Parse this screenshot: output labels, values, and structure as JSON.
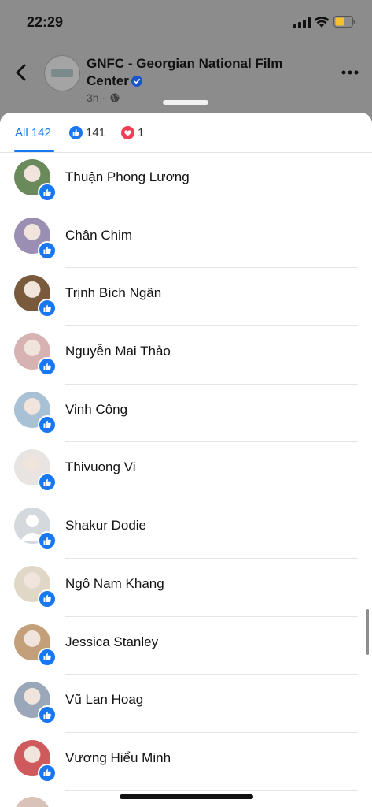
{
  "status_bar": {
    "time": "22:29"
  },
  "post": {
    "page_name": "GNFC - Georgian National Film Center",
    "time_ago": "3h",
    "separator": "·"
  },
  "tabs": {
    "all": "All 142",
    "like_count": "141",
    "love_count": "1"
  },
  "colors": {
    "accent": "#1877f2",
    "love": "#f33e58"
  },
  "icons": {
    "back": "chevron-left-icon",
    "more": "more-horizontal-icon",
    "verified": "verified-badge-icon",
    "globe": "globe-icon",
    "like": "thumbs-up-icon",
    "love": "heart-icon"
  },
  "people": [
    {
      "name": "Thuận Phong Lương",
      "avatar": "#6a8a5c"
    },
    {
      "name": "Chân Chim",
      "avatar": "#9a8fb3"
    },
    {
      "name": "Trịnh Bích Ngân",
      "avatar": "#7a5a3c"
    },
    {
      "name": "Nguyễn Mai Thảo",
      "avatar": "#d7b2b2"
    },
    {
      "name": "Vinh Công",
      "avatar": "#a9c1d4"
    },
    {
      "name": "Thivuong Vi",
      "avatar": "#e7e4e2"
    },
    {
      "name": "Shakur Dodie",
      "avatar": "default"
    },
    {
      "name": "Ngô Nam Khang",
      "avatar": "#e1d7c6"
    },
    {
      "name": "Jessica Stanley",
      "avatar": "#c4a07a"
    },
    {
      "name": "Vũ Lan Hoag",
      "avatar": "#9aa7b8"
    },
    {
      "name": "Vương Hiểu Minh",
      "avatar": "#cf5a5e"
    }
  ]
}
